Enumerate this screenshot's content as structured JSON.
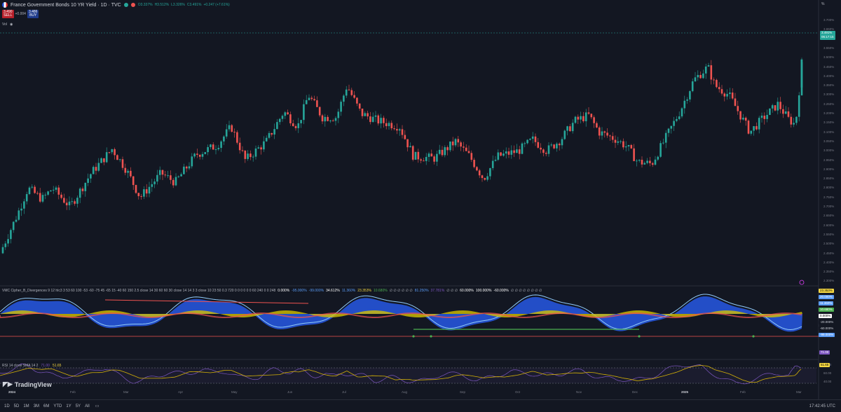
{
  "header": {
    "title": "France Government Bonds 10 YR Yield · 1D · TVC",
    "ohlc": {
      "o": "O3.337%",
      "h": "H3.512%",
      "l": "L3.326%",
      "c": "C3.491%",
      "chg": "+0.247 (+7.61%)"
    }
  },
  "price_boxes": {
    "sell_val": "3.490",
    "sell_sub": "SELL",
    "spread": "+0.004",
    "buy_val": "3.486",
    "buy_sub": "BUY"
  },
  "vol_label": "Vol",
  "price_axis": [
    "3.700%",
    "3.650%",
    "3.600%",
    "3.550%",
    "3.500%",
    "3.450%",
    "3.400%",
    "3.350%",
    "3.300%",
    "3.250%",
    "3.200%",
    "3.150%",
    "3.100%",
    "3.050%",
    "3.000%",
    "2.950%",
    "2.900%",
    "2.850%",
    "2.800%",
    "2.750%",
    "2.700%",
    "2.650%",
    "2.600%",
    "2.550%",
    "2.500%",
    "2.450%",
    "2.400%",
    "2.350%",
    "2.300%",
    "2.250%"
  ],
  "last_price_tag": "3.491%",
  "last_price_time": "06:17:15",
  "vmc": {
    "title": "VMC Cipher_B_Divergences 9 12 hlc3 3 53 60 100 -53 -60 -75 45 -65 15 -40 60 150 2.5 close 14 30 60 60 30 close 14 14 3 3 close 10 23 50 0.3 720 0 0 0 0 0 0 60 240 0 0 248",
    "values": [
      "0.000%",
      "-95.000%",
      "-99.000%",
      "34.612%",
      "11.360%",
      "23.353%",
      "10.680%",
      "∅ ∅ ∅ ∅ ∅ ∅",
      "81.250%",
      "37.781%",
      "∅ ∅ ∅",
      "60.000%",
      "100.000%",
      "-60.000%",
      "∅ ∅ ∅ ∅ ∅ ∅ ∅ ∅"
    ],
    "axis": [
      "23.353%",
      "20.000%",
      "11.360%",
      "10.680%",
      "0.000%",
      "-20.000%",
      "-60.000%",
      "-99.000%"
    ]
  },
  "rsi": {
    "title": "RSI 14 close SMA 14 2",
    "v1": "71.00",
    "v2": "51.65",
    "axis": [
      "80.00",
      "60.00",
      "40.00"
    ]
  },
  "time_axis": [
    "2024",
    "Feb",
    "Mar",
    "Apr",
    "May",
    "Jun",
    "Jul",
    "Aug",
    "Sep",
    "Oct",
    "Nov",
    "Dec",
    "2025",
    "Feb",
    "Mar"
  ],
  "brand": "TradingView",
  "bottom": {
    "ranges": [
      "1D",
      "5D",
      "1M",
      "3M",
      "6M",
      "YTD",
      "1Y",
      "5Y",
      "All"
    ],
    "clock": "17:42:45 UTC",
    "percent": "%"
  },
  "colors": {
    "up": "#26a69a",
    "down": "#ef5350",
    "bg": "#131722"
  }
}
